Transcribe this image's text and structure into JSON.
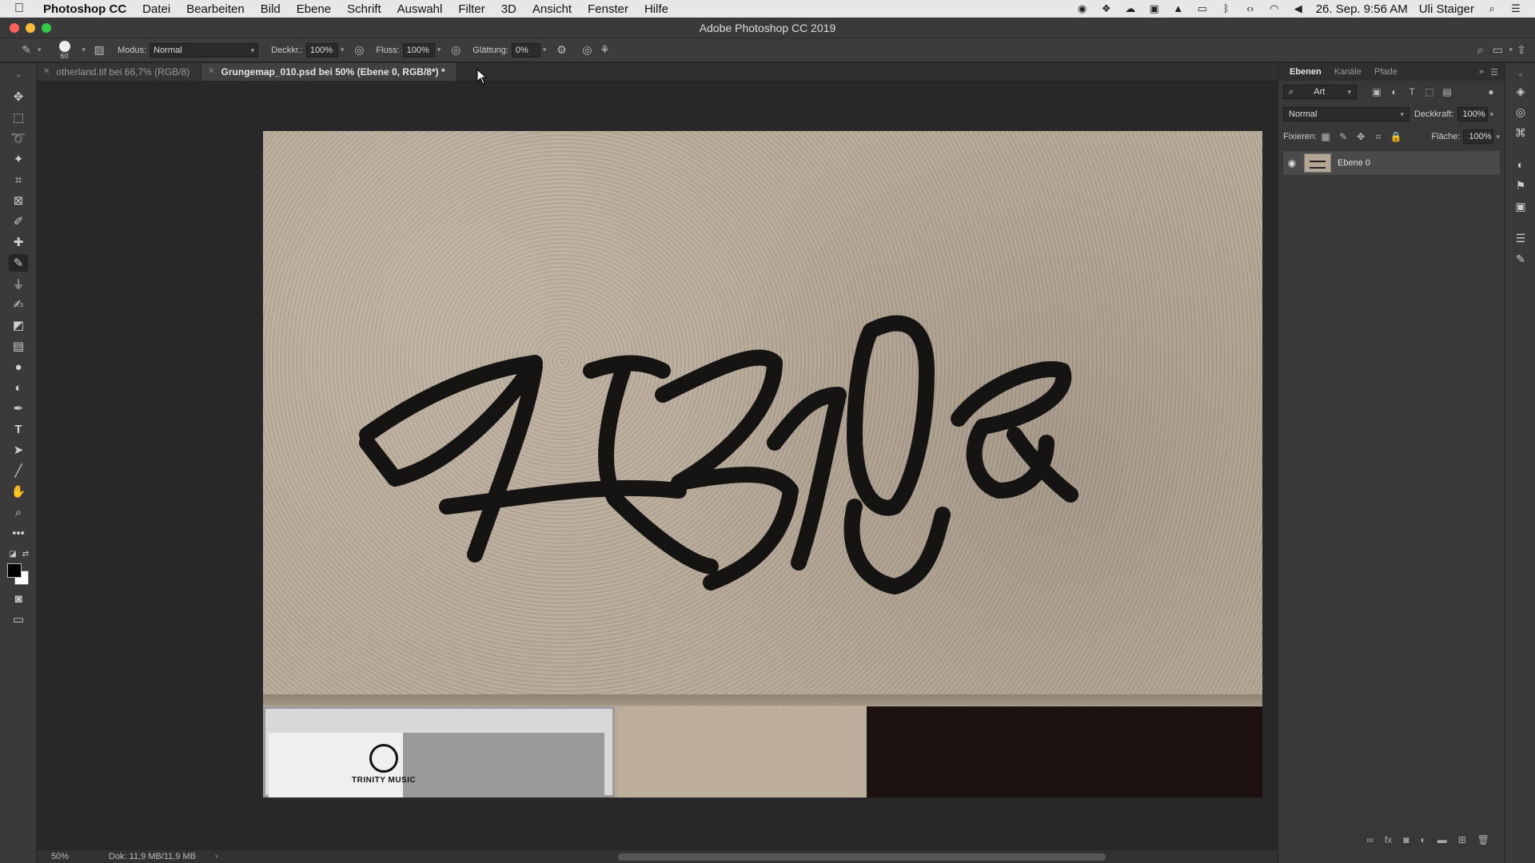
{
  "menubar": {
    "app_name": "Photoshop CC",
    "items": [
      "Datei",
      "Bearbeiten",
      "Bild",
      "Ebene",
      "Schrift",
      "Auswahl",
      "Filter",
      "3D",
      "Ansicht",
      "Fenster",
      "Hilfe"
    ],
    "clock": "26. Sep.  9:56 AM",
    "user": "Uli Staiger"
  },
  "window": {
    "title": "Adobe Photoshop CC 2019"
  },
  "options": {
    "brush_size": "60",
    "mode_label": "Modus:",
    "mode_value": "Normal",
    "opacity_label": "Deckkr.:",
    "opacity_value": "100%",
    "flow_label": "Fluss:",
    "flow_value": "100%",
    "smoothing_label": "Glättung:",
    "smoothing_value": "0%"
  },
  "tabs": [
    {
      "label": "otherland.tif bei 66,7% (RGB/8)"
    },
    {
      "label": "Grungemap_010.psd bei 50% (Ebene 0, RGB/8*) *"
    }
  ],
  "document": {
    "poster_text": "TRINITY MUSIC"
  },
  "status": {
    "zoom": "50%",
    "doc_info": "Dok: 11,9 MB/11,9 MB",
    "arrow": "›"
  },
  "layers_panel": {
    "tabs": [
      "Ebenen",
      "Kanäle",
      "Pfade"
    ],
    "filter_value": "Art",
    "blend_mode": "Normal",
    "opacity_label": "Deckkraft:",
    "opacity_value": "100%",
    "lock_label": "Fixieren:",
    "fill_label": "Fläche:",
    "fill_value": "100%",
    "layers": [
      {
        "name": "Ebene 0"
      }
    ]
  },
  "colors": {
    "foreground": "#000000",
    "background": "#ffffff",
    "accent_red": "#fc605c",
    "accent_yellow": "#fdbc40",
    "accent_green": "#34c84a"
  }
}
